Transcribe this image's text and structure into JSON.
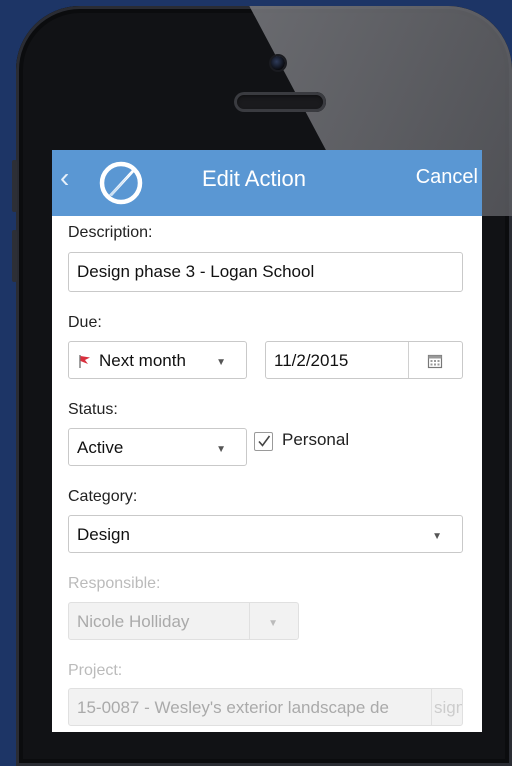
{
  "header": {
    "title": "Edit Action",
    "cancel_label": "Cancel"
  },
  "form": {
    "description": {
      "label": "Description:",
      "value": "Design phase 3 - Logan School"
    },
    "due": {
      "label": "Due:",
      "preset": "Next month",
      "date": "11/2/2015"
    },
    "status": {
      "label": "Status:",
      "value": "Active",
      "personal_label": "Personal",
      "personal_checked": true
    },
    "category": {
      "label": "Category:",
      "value": "Design"
    },
    "responsible": {
      "label": "Responsible:",
      "value": "Nicole Holliday"
    },
    "project": {
      "label": "Project:",
      "value": "15-0087 - Wesley's exterior landscape de",
      "button_text": "sign"
    }
  },
  "icons": {
    "back": "chevron-left-icon",
    "logo": "app-logo-icon",
    "flag": "flag-icon",
    "calendar": "calendar-icon",
    "dropdown": "caret-down-icon",
    "check": "check-icon"
  },
  "colors": {
    "background": "#1d3566",
    "appbar": "#5a97d3",
    "flag": "#d9303e"
  }
}
